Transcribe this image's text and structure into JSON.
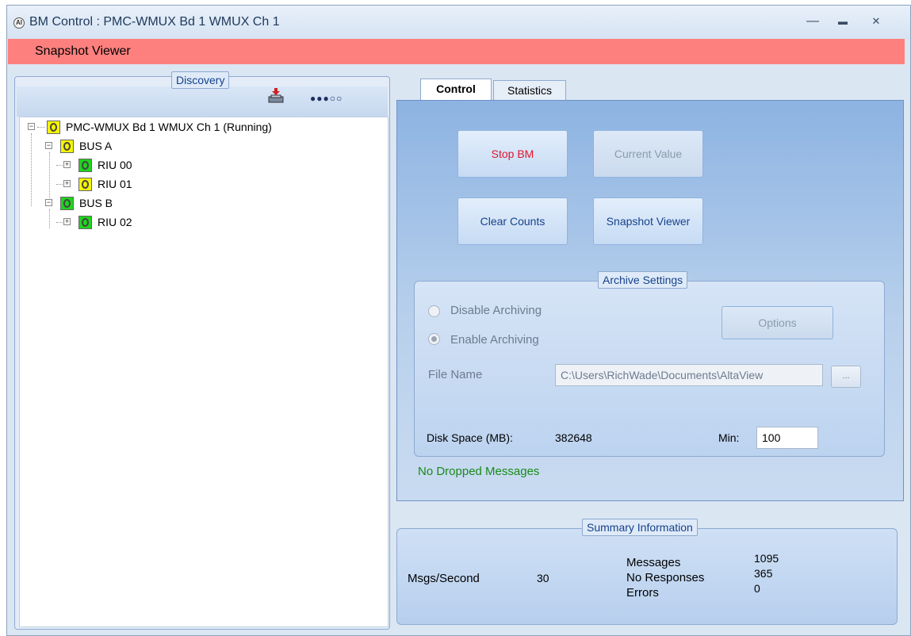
{
  "window": {
    "title": "BM Control : PMC-WMUX Bd 1 WMUX Ch 1",
    "app_icon_label": "AI",
    "minimize": "—",
    "maximize": "▬",
    "close": "✕"
  },
  "banner": {
    "label": "Snapshot Viewer",
    "color": "#fd807e"
  },
  "discovery": {
    "title": "Discovery",
    "progress_dots": "●●●○○",
    "tree": [
      {
        "label": "PMC-WMUX Bd 1 WMUX Ch 1 (Running)",
        "status": "yellow",
        "expander": "−"
      },
      {
        "label": "BUS A",
        "status": "yellow",
        "expander": "−"
      },
      {
        "label": "RIU 00",
        "status": "green",
        "expander": "+"
      },
      {
        "label": "RIU 01",
        "status": "yellow",
        "expander": "+"
      },
      {
        "label": "BUS B",
        "status": "green",
        "expander": "−"
      },
      {
        "label": "RIU 02",
        "status": "green",
        "expander": "+"
      }
    ]
  },
  "tabs": [
    {
      "label": "Control",
      "active": true
    },
    {
      "label": "Statistics",
      "active": false
    }
  ],
  "control": {
    "stop_bm": "Stop BM",
    "current_value": "Current Value",
    "clear_counts": "Clear Counts",
    "snapshot_viewer": "Snapshot Viewer"
  },
  "archive": {
    "title": "Archive Settings",
    "disable_label": "Disable Archiving",
    "enable_label": "Enable Archiving",
    "options_label": "Options",
    "file_name_label": "File Name",
    "file_name_value": "C:\\Users\\RichWade\\Documents\\AltaView",
    "browse_label": "...",
    "disk_space_label": "Disk Space (MB):",
    "disk_space_value": "382648",
    "min_label": "Min:",
    "min_value": "100"
  },
  "status_message": "No Dropped Messages",
  "summary": {
    "title": "Summary Information",
    "msgs_per_second_label": "Msgs/Second",
    "msgs_per_second_value": "30",
    "messages_label": "Messages",
    "messages_value": "1095",
    "no_responses_label": "No Responses",
    "no_responses_value": "365",
    "errors_label": "Errors",
    "errors_value": "0"
  }
}
